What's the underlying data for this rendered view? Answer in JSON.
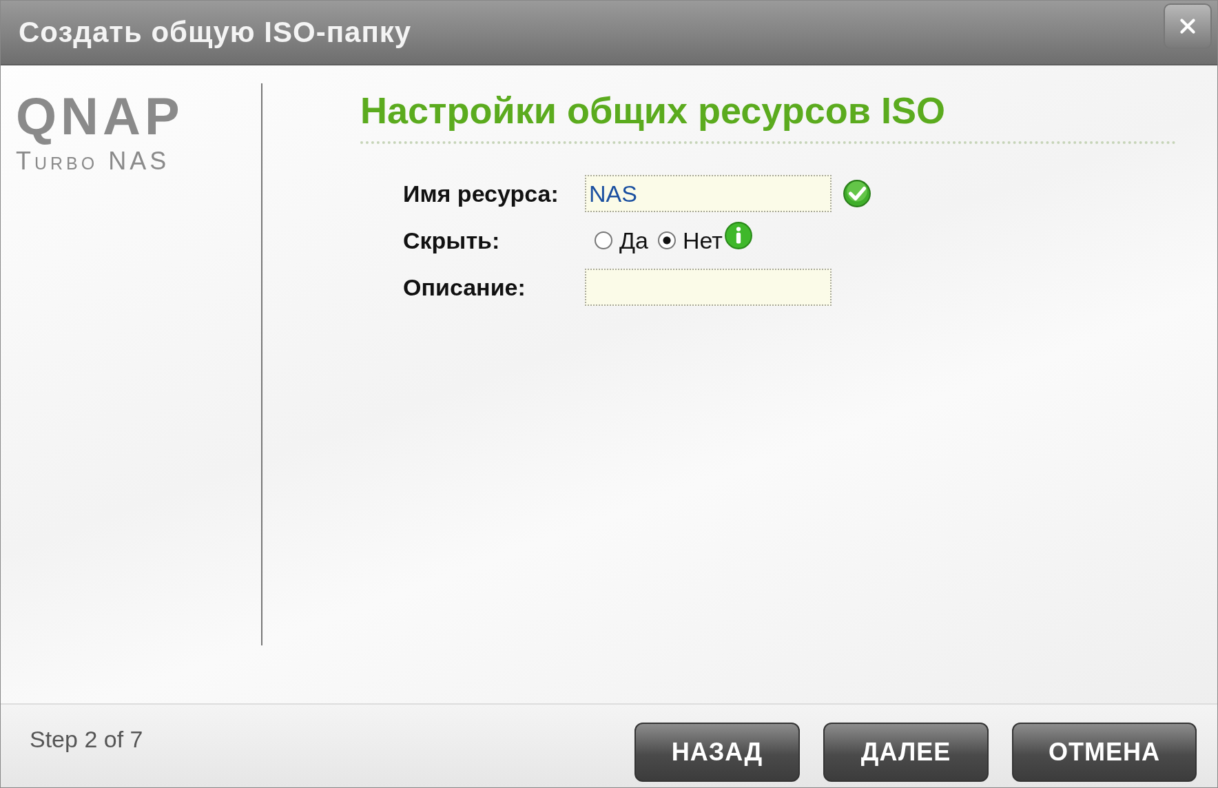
{
  "window": {
    "title": "Создать общую ISO-папку"
  },
  "logo": {
    "name": "QNAP",
    "subtitle": "Turbo NAS"
  },
  "heading": "Настройки общих ресурсов ISO",
  "form": [
    {
      "kind": "text",
      "label": "Имя ресурса:",
      "value": "NAS",
      "valid": true
    },
    {
      "kind": "radio",
      "label": "Скрыть:",
      "options": [
        {
          "label": "Да",
          "selected": false
        },
        {
          "label": "Нет",
          "selected": true
        }
      ],
      "info": true
    },
    {
      "kind": "text",
      "label": "Описание:"
    }
  ],
  "footer": {
    "step": "Step 2 of 7",
    "buttons": [
      "НАЗАД",
      "ДАЛЕЕ",
      "ОТМЕНА"
    ]
  }
}
